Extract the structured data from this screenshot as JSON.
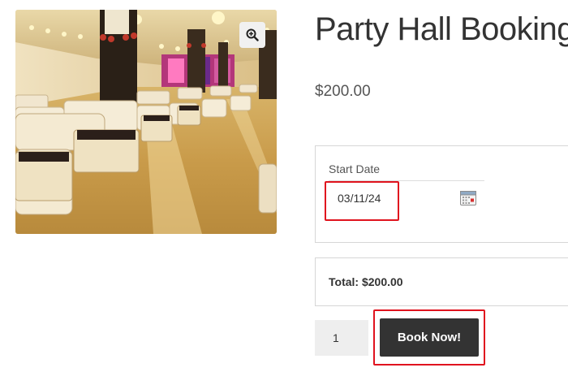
{
  "product": {
    "image_icon": "zoom-in-icon",
    "title": "Party Hall Booking",
    "price": "$200.00"
  },
  "booking": {
    "start_date_label": "Start Date",
    "start_date_value": "03/11/24",
    "calendar_icon": "calendar-icon"
  },
  "total": {
    "text": "Total: $200.00"
  },
  "cart": {
    "quantity": "1",
    "book_label": "Book Now!"
  },
  "colors": {
    "button_bg": "#333333",
    "highlight": "#e0131e",
    "border": "#d6d6d6"
  }
}
